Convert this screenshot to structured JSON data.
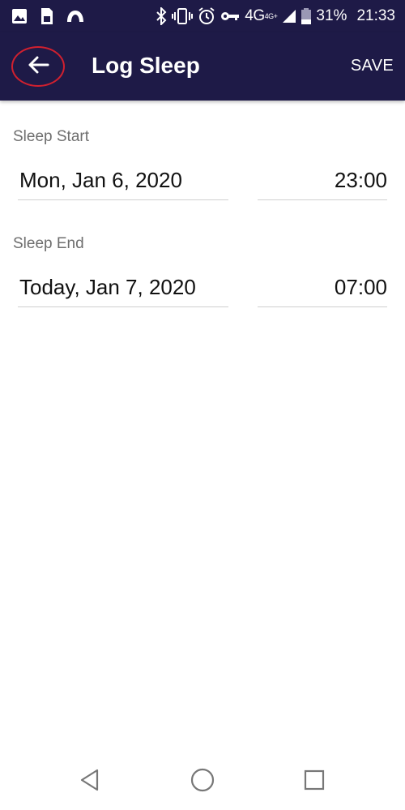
{
  "status_bar": {
    "network": "4G",
    "network_badge": "4G+",
    "battery": "31%",
    "time": "21:33",
    "icons": [
      "image-icon",
      "sim-card-icon",
      "vpn-icon",
      "bluetooth-icon",
      "vibrate-icon",
      "alarm-icon",
      "key-icon",
      "signal-icon",
      "battery-icon"
    ]
  },
  "app_bar": {
    "title": "Log Sleep",
    "save_label": "SAVE",
    "back_icon": "arrow-left-icon"
  },
  "sleep_start": {
    "label": "Sleep Start",
    "date": "Mon, Jan 6, 2020",
    "time": "23:00"
  },
  "sleep_end": {
    "label": "Sleep End",
    "date": "Today, Jan 7, 2020",
    "time": "07:00"
  },
  "nav_bar": {
    "buttons": [
      "back-triangle-icon",
      "home-circle-icon",
      "recents-square-icon"
    ]
  },
  "colors": {
    "app_bar": "#1e1a47",
    "annotation_circle": "#d0202f",
    "label_gray": "#6e6e6e"
  }
}
